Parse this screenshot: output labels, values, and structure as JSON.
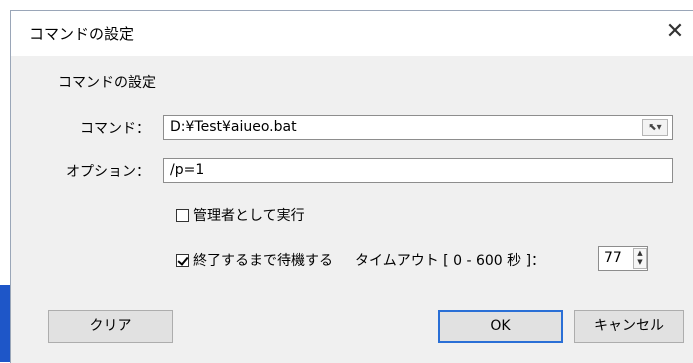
{
  "window": {
    "title": "コマンドの設定",
    "close_glyph": "✕"
  },
  "group": {
    "label": "コマンドの設定"
  },
  "command": {
    "label": "コマンド：",
    "value": "D:¥Test¥aiueo.bat",
    "browse_glyph": "⬉▾"
  },
  "options": {
    "label": "オプション：",
    "value": "/p=1"
  },
  "run_as_admin": {
    "label": "管理者として実行",
    "checked": false
  },
  "wait_until_done": {
    "label": "終了するまで待機する",
    "checked": true
  },
  "timeout": {
    "label": "タイムアウト [ 0 - 600 秒 ]：",
    "value": "77"
  },
  "buttons": {
    "clear": "クリア",
    "ok": "OK",
    "cancel": "キャンセル"
  },
  "colors": {
    "accent": "#1e56c8",
    "dialog_bg": "#f0f0f0",
    "default_button_border": "#2a6fd6"
  }
}
